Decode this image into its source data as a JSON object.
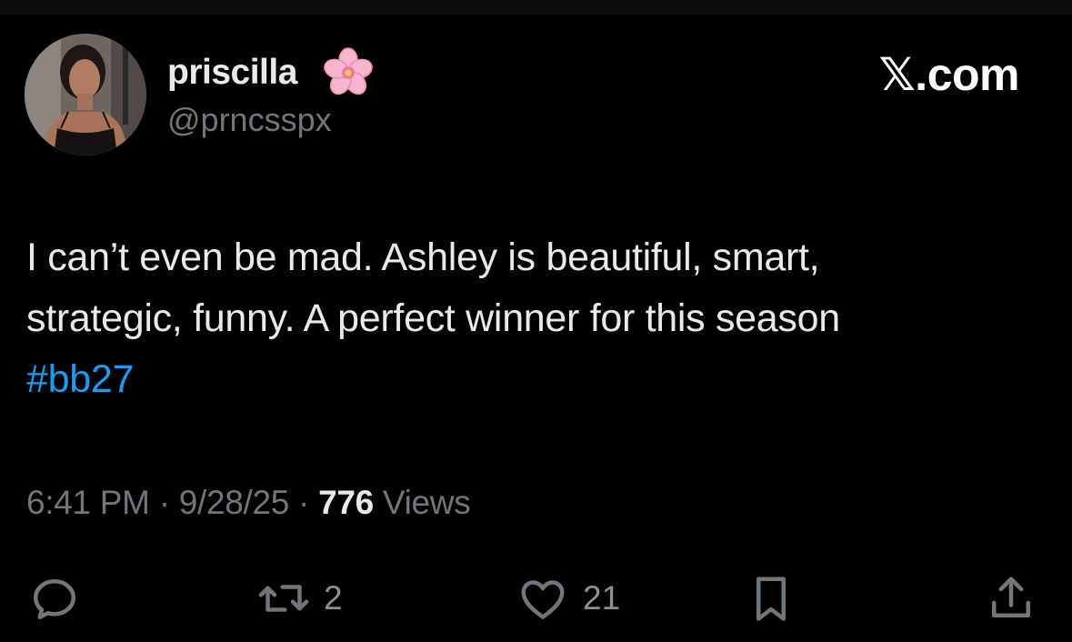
{
  "author": {
    "display_name": "priscilla",
    "name_emoji": "cherry-blossom-emoji",
    "handle": "@prncsspx",
    "avatar": "profile-photo"
  },
  "source_label": "𝕏.com",
  "tweet": {
    "text_lines": [
      "I can’t even be mad. Ashley is beautiful, smart,",
      "strategic, funny. A perfect winner for this season"
    ],
    "hashtag": "#bb27"
  },
  "meta": {
    "time": "6:41 PM",
    "separator": "·",
    "date": "9/28/25",
    "views_count": "776",
    "views_label": "Views"
  },
  "actions": {
    "reply": {
      "icon": "reply-icon"
    },
    "retweet": {
      "icon": "retweet-icon",
      "count": "2"
    },
    "like": {
      "icon": "heart-icon",
      "count": "21"
    },
    "bookmark": {
      "icon": "bookmark-icon"
    },
    "share": {
      "icon": "share-icon"
    }
  },
  "colors": {
    "background": "#000000",
    "text": "#e7e9ea",
    "secondary": "#71767b",
    "link": "#1d9bf0"
  }
}
